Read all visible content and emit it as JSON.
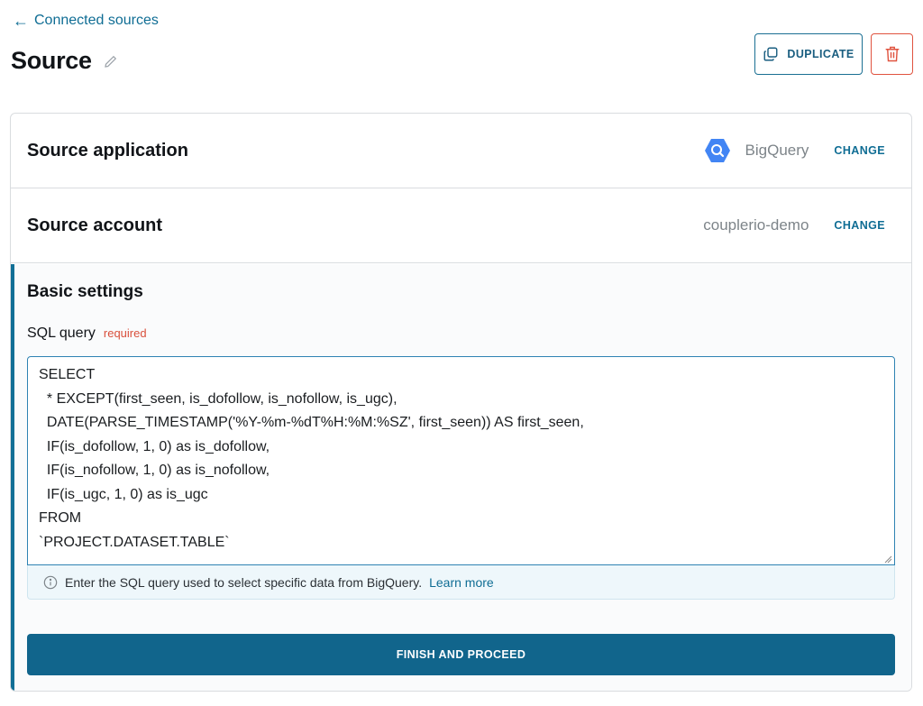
{
  "nav": {
    "back_label": "Connected sources"
  },
  "header": {
    "title": "Source",
    "duplicate_label": "DUPLICATE"
  },
  "source_application": {
    "title": "Source application",
    "value": "BigQuery",
    "change_label": "CHANGE"
  },
  "source_account": {
    "title": "Source account",
    "value": "couplerio-demo",
    "change_label": "CHANGE"
  },
  "basic_settings": {
    "title": "Basic settings",
    "sql_label": "SQL query",
    "required_label": "required",
    "sql_value": "SELECT\n  * EXCEPT(first_seen, is_dofollow, is_nofollow, is_ugc),\n  DATE(PARSE_TIMESTAMP('%Y-%m-%dT%H:%M:%SZ', first_seen)) AS first_seen,\n  IF(is_dofollow, 1, 0) as is_dofollow,\n  IF(is_nofollow, 1, 0) as is_nofollow,\n  IF(is_ugc, 1, 0) as is_ugc\nFROM\n`PROJECT.DATASET.TABLE`",
    "help_text": "Enter the SQL query used to select specific data from BigQuery.",
    "learn_more_label": "Learn more"
  },
  "finish_label": "FINISH AND PROCEED",
  "colors": {
    "accent": "#11658c",
    "danger": "#e0533f",
    "bigquery": "#4285f4"
  }
}
